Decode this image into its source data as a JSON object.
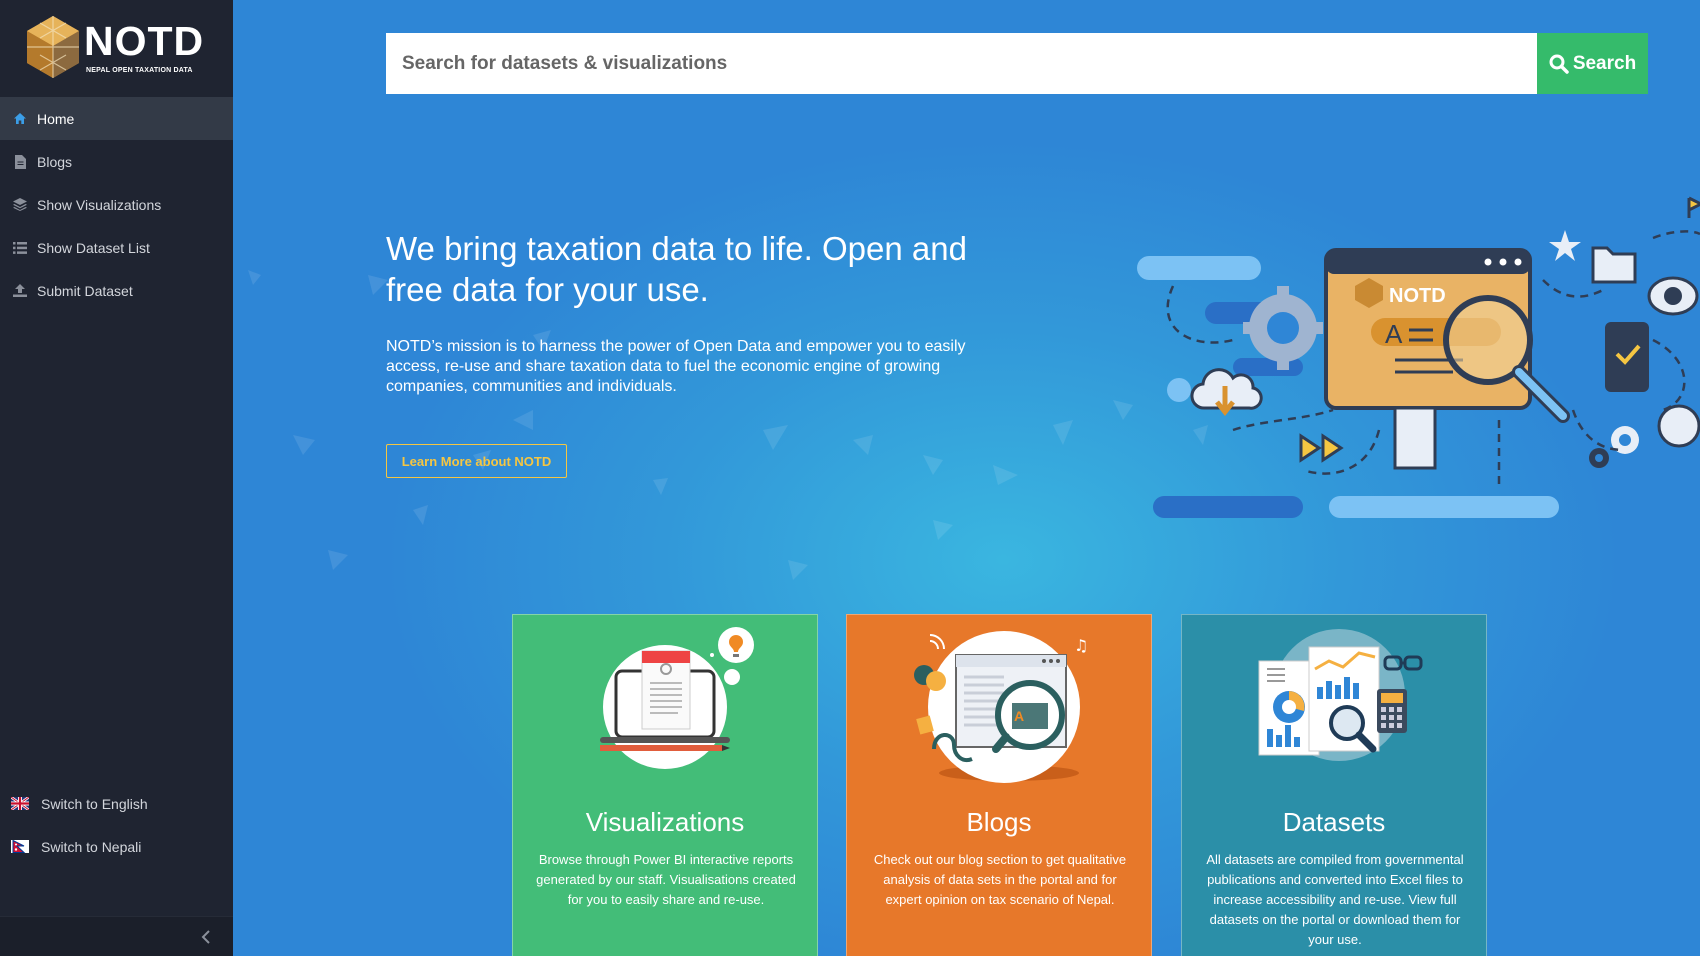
{
  "sidebar": {
    "logo_title": "NOTD",
    "logo_subtitle": "NEPAL OPEN TAXATION DATA",
    "items": [
      {
        "label": "Home",
        "icon": "home-icon"
      },
      {
        "label": "Blogs",
        "icon": "file-icon"
      },
      {
        "label": "Show Visualizations",
        "icon": "layers-icon"
      },
      {
        "label": "Show Dataset List",
        "icon": "list-icon"
      },
      {
        "label": "Submit Dataset",
        "icon": "upload-icon"
      }
    ],
    "languages": [
      {
        "label": "Switch to English",
        "icon": "uk-flag-icon"
      },
      {
        "label": "Switch to Nepali",
        "icon": "nepal-flag-icon"
      }
    ]
  },
  "search": {
    "placeholder": "Search for datasets & visualizations",
    "button_label": "Search"
  },
  "hero": {
    "title": "We bring taxation data to life. Open and free data for your use.",
    "text": "NOTD’s mission is to harness the power of Open Data and empower you to easily access, re-use and share taxation data to fuel the economic engine of growing companies, communities and individuals.",
    "button_label": "Learn More about NOTD",
    "illustration_logo": "NOTD",
    "illustration_glyph": "A"
  },
  "cards": [
    {
      "title": "Visualizations",
      "text": "Browse through Power BI interactive reports generated by our staff. Visualisations created for you to easily share and re-use.",
      "color": "#43bd78"
    },
    {
      "title": "Blogs",
      "text": "Check out our blog section to get qualitative analysis of data sets in the portal and for expert opinion on tax scenario of Nepal.",
      "color": "#e7782a"
    },
    {
      "title": "Datasets",
      "text": "All datasets are compiled from governmental publications and converted into Excel files to increase accessibility and re-use. View full datasets on the portal or download them for your use.",
      "color": "#2b8fa8"
    }
  ],
  "colors": {
    "sidebar_bg": "#1f2431",
    "main_bg": "#2f86d6",
    "search_button": "#35bb6b",
    "accent_yellow": "#f5c642"
  }
}
